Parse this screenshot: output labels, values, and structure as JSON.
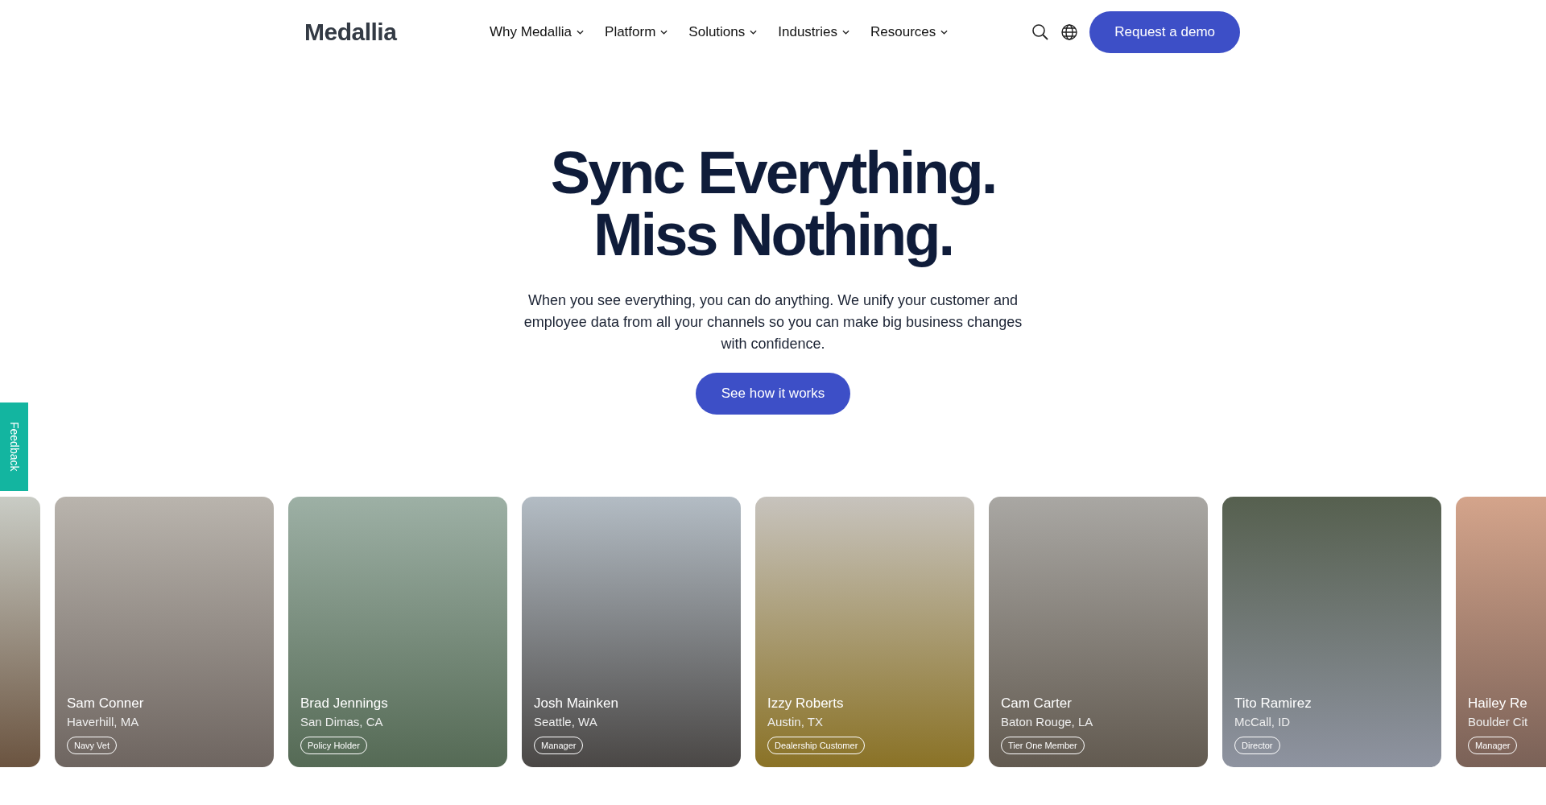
{
  "header": {
    "logo": "Medallia",
    "nav": [
      {
        "label": "Why Medallia"
      },
      {
        "label": "Platform"
      },
      {
        "label": "Solutions"
      },
      {
        "label": "Industries"
      },
      {
        "label": "Resources"
      }
    ],
    "cta": "Request a demo"
  },
  "hero": {
    "title_lines": [
      "Sync Everything.",
      "Miss Nothing."
    ],
    "text": "When you see everything, you can do anything. We unify your customer and employee data from all your channels so you can make big business changes with confidence.",
    "button": "See how it works"
  },
  "feedback_tab": "Feedback",
  "cards": [
    {
      "name": "Sam Conner",
      "location": "Haverhill, MA",
      "tag": "Navy Vet"
    },
    {
      "name": "Brad Jennings",
      "location": "San Dimas, CA",
      "tag": "Policy Holder"
    },
    {
      "name": "Josh Mainken",
      "location": "Seattle, WA",
      "tag": "Manager"
    },
    {
      "name": "Izzy Roberts",
      "location": "Austin, TX",
      "tag": "Dealership Customer"
    },
    {
      "name": "Cam Carter",
      "location": "Baton Rouge, LA",
      "tag": "Tier One Member"
    },
    {
      "name": "Tito Ramirez",
      "location": "McCall, ID",
      "tag": "Director"
    },
    {
      "name": "Hailey Re",
      "location": "Boulder Cit",
      "tag": "Manager"
    }
  ]
}
